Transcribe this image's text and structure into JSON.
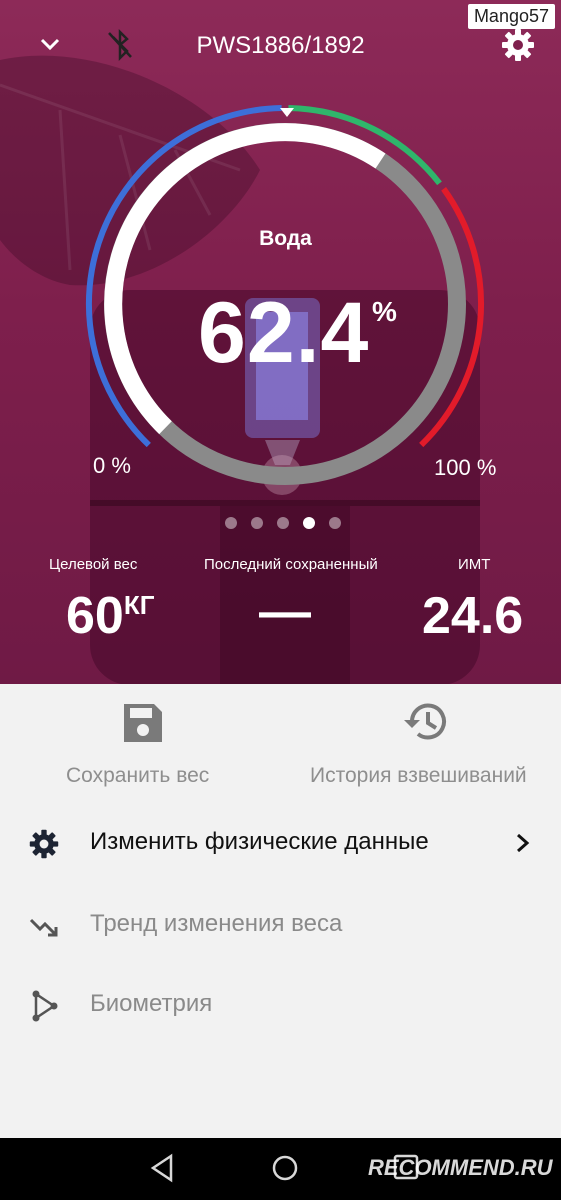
{
  "watermark": "Mango57",
  "header": {
    "device_title": "PWS1886/1892"
  },
  "gauge": {
    "metric_label": "Вода",
    "metric_value": "62.4",
    "metric_unit": "%",
    "min_label": "0 %",
    "max_label": "100 %",
    "value_fraction": 0.624,
    "page_count": 5,
    "active_page": 4
  },
  "stats": {
    "target_weight": {
      "label": "Целевой вес",
      "value": "60",
      "unit": "КГ"
    },
    "last_saved": {
      "label": "Последний сохраненный",
      "value": "—"
    },
    "bmi": {
      "label": "ИМТ",
      "value": "24.6"
    }
  },
  "actions": {
    "save_weight": "Сохранить вес",
    "history": "История взвешиваний"
  },
  "menu": {
    "items": [
      {
        "label": "Изменить физические данные",
        "icon": "gear-icon"
      },
      {
        "label": "Тренд изменения веса",
        "icon": "trend-down-icon"
      },
      {
        "label": "Биометрия",
        "icon": "biometry-icon"
      }
    ]
  },
  "footer_watermark": "RECOMMEND.RU",
  "colors": {
    "hero_bg": "#7e1f4c",
    "gauge_blue": "#3d6fd9",
    "gauge_green": "#2fb66b",
    "gauge_red": "#e21b2a",
    "track_grey": "#8a8a8a",
    "fill_white": "#ffffff"
  }
}
